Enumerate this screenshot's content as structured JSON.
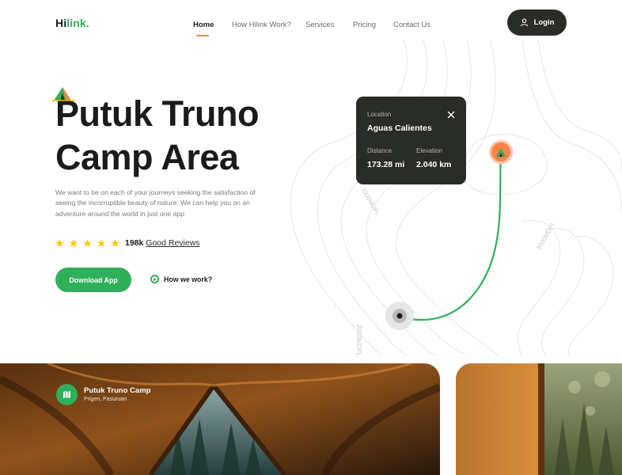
{
  "brand": {
    "name_dark": "Hi",
    "name_green": "link."
  },
  "nav": {
    "links": [
      "Home",
      "How Hilink Work?",
      "Services",
      "Pricing",
      "Contact Us"
    ],
    "active": "Home",
    "login_label": "Login"
  },
  "hero": {
    "title_line1": "Putuk Truno",
    "title_line2": "Camp Area",
    "description": "We want to be on each of your journeys seeking the satisfaction of seeing the incorruptible beauty of nature. We can help you on an adventure around the world in just one app",
    "rating_stars": 5,
    "reviews_count": "198k",
    "reviews_label": "Good Reviews",
    "download_label": "Download App",
    "how_label": "How we work?"
  },
  "map": {
    "labels": [
      "2000MDPL",
      "3000MDPL",
      "2000MDPL"
    ]
  },
  "location_card": {
    "location_label": "Location",
    "location_value": "Aguas Calientes",
    "distance_label": "Distance",
    "distance_value": "173.28 mi",
    "elevation_label": "Elevation",
    "elevation_value": "2.040 km"
  },
  "camp_card": {
    "title": "Putuk Truno Camp",
    "subtitle": "Prigen, Pasuruan"
  },
  "colors": {
    "green": "#30af5b",
    "dark": "#292c27",
    "orange": "#ff814c",
    "star": "#fec601"
  },
  "icons": {
    "user": "user-icon",
    "tent": "tent-icon",
    "star": "star-icon",
    "play": "play-icon",
    "close": "close-icon",
    "map": "map-icon"
  }
}
